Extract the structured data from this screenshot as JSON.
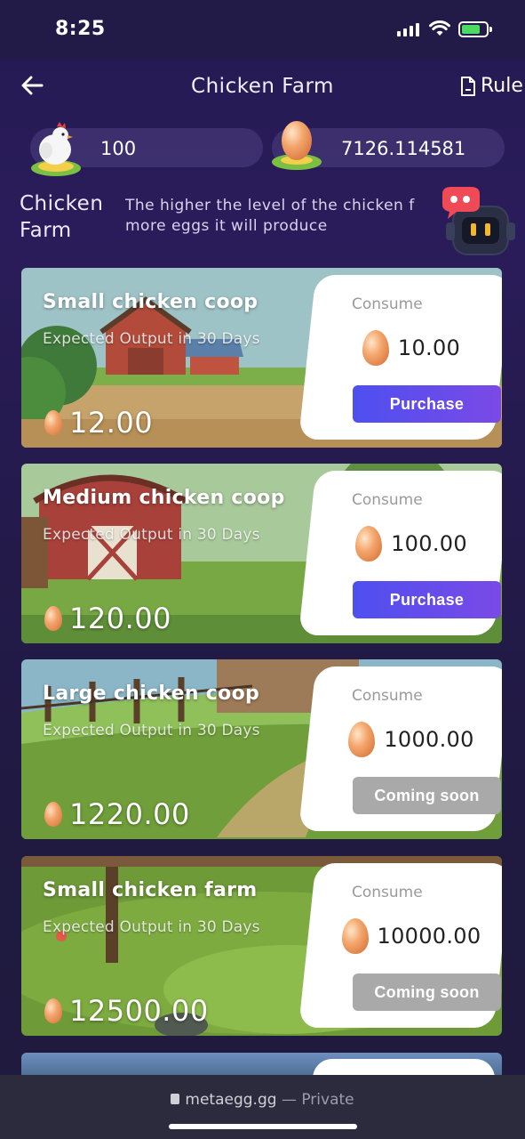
{
  "status": {
    "time": "8:25"
  },
  "header": {
    "title": "Chicken Farm",
    "rules_label": "Rule"
  },
  "balances": {
    "chickens": "100",
    "eggs": "7126.114581"
  },
  "intro": {
    "title_line1": "Chicken",
    "title_line2": "Farm",
    "desc_line1": "The higher the level of the chicken f",
    "desc_line2": "more eggs it will produce"
  },
  "cards": [
    {
      "name": "Small chicken coop",
      "sub": "Expected Output in 30 Days",
      "output": "12.00",
      "consume_label": "Consume",
      "price": "10.00",
      "button": "Purchase",
      "button_state": "active"
    },
    {
      "name": "Medium chicken coop",
      "sub": "Expected Output in 30 Days",
      "output": "120.00",
      "consume_label": "Consume",
      "price": "100.00",
      "button": "Purchase",
      "button_state": "active"
    },
    {
      "name": "Large chicken coop",
      "sub": "Expected Output in 30 Days",
      "output": "1220.00",
      "consume_label": "Consume",
      "price": "1000.00",
      "button": "Coming soon",
      "button_state": "disabled"
    },
    {
      "name": "Small chicken farm",
      "sub": "Expected Output in 30 Days",
      "output": "12500.00",
      "consume_label": "Consume",
      "price": "10000.00",
      "button": "Coming soon",
      "button_state": "disabled"
    }
  ],
  "browser": {
    "domain": "metaegg.gg",
    "privacy": "— Private"
  },
  "colors": {
    "accent": "#5a4cec",
    "disabled": "#a9a9a9",
    "background": "#241a52"
  }
}
